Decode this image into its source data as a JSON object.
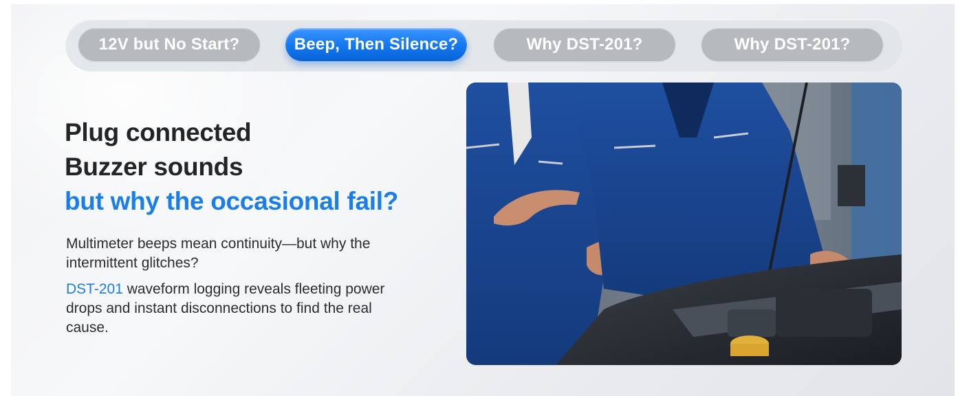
{
  "tabs": [
    {
      "label": "12V but No Start?",
      "active": false
    },
    {
      "label": "Beep, Then Silence?",
      "active": true
    },
    {
      "label": "Why DST-201?",
      "active": false
    },
    {
      "label": "Why DST-201?",
      "active": false
    }
  ],
  "headline": {
    "line1": "Plug connected",
    "line2": "Buzzer sounds",
    "line3": "but why the occasional fail?"
  },
  "body": {
    "paragraph1": "Multimeter beeps mean continuity—but why the intermittent glitches?",
    "brand": "DST-201",
    "paragraph2_rest": " waveform logging reveals fleeting power drops and instant disconnections to find the real cause."
  },
  "colors": {
    "accent": "#1a7ee8",
    "tab_inactive": "#b6b9be",
    "headline": "#222426",
    "background": "#eef0f3"
  },
  "photo": {
    "subject": "two mechanics in blue coveralls discussing over an open car engine bay"
  }
}
